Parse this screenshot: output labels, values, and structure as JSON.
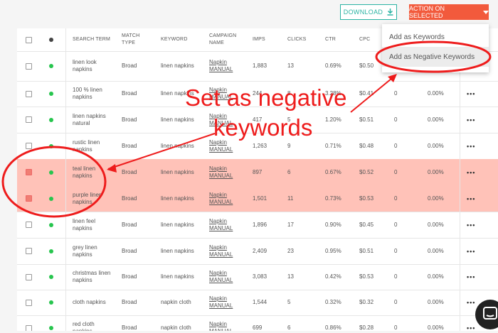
{
  "toolbar": {
    "download_label": "DOWNLOAD",
    "action_label": "ACTION ON SELECTED",
    "download_icon": "download-icon",
    "caret_icon": "caret-down-icon"
  },
  "columns": {
    "search_term": "SEARCH TERM",
    "match_type": "MATCH TYPE",
    "keyword": "KEYWORD",
    "campaign": "CAMPAIGN NAME",
    "imps": "IMPS",
    "clicks": "CLICKS",
    "ctr": "CTR",
    "cpc": "CPC"
  },
  "rows": [
    {
      "term": "linen look napkins",
      "match": "Broad",
      "keyword": "linen napkins",
      "campaign": "Napkin MANUAL",
      "imps": "1,883",
      "clicks": "13",
      "ctr": "0.69%",
      "cpc": "$0.50",
      "extra1": "",
      "extra2": "",
      "checked": false
    },
    {
      "term": "100 % linen napkins",
      "match": "Broad",
      "keyword": "linen napkins",
      "campaign": "Napkin MANUAL",
      "imps": "244",
      "clicks": "8",
      "ctr": "3.28%",
      "cpc": "$0.41",
      "extra1": "0",
      "extra2": "0.00%",
      "checked": false
    },
    {
      "term": "linen napkins natural",
      "match": "Broad",
      "keyword": "linen napkins",
      "campaign": "Napkin MANUAL",
      "imps": "417",
      "clicks": "5",
      "ctr": "1.20%",
      "cpc": "$0.51",
      "extra1": "0",
      "extra2": "0.00%",
      "checked": false
    },
    {
      "term": "rustic linen napkins",
      "match": "Broad",
      "keyword": "linen napkins",
      "campaign": "Napkin MANUAL",
      "imps": "1,263",
      "clicks": "9",
      "ctr": "0.71%",
      "cpc": "$0.48",
      "extra1": "0",
      "extra2": "0.00%",
      "checked": false
    },
    {
      "term": "teal linen napkins",
      "match": "Broad",
      "keyword": "linen napkins",
      "campaign": "Napkin MANUAL",
      "imps": "897",
      "clicks": "6",
      "ctr": "0.67%",
      "cpc": "$0.52",
      "extra1": "0",
      "extra2": "0.00%",
      "checked": true
    },
    {
      "term": "purple linen napkins",
      "match": "Broad",
      "keyword": "linen napkins",
      "campaign": "Napkin MANUAL",
      "imps": "1,501",
      "clicks": "11",
      "ctr": "0.73%",
      "cpc": "$0.53",
      "extra1": "0",
      "extra2": "0.00%",
      "checked": true
    },
    {
      "term": "linen feel napkins",
      "match": "Broad",
      "keyword": "linen napkins",
      "campaign": "Napkin MANUAL",
      "imps": "1,896",
      "clicks": "17",
      "ctr": "0.90%",
      "cpc": "$0.45",
      "extra1": "0",
      "extra2": "0.00%",
      "checked": false
    },
    {
      "term": "grey linen napkins",
      "match": "Broad",
      "keyword": "linen napkins",
      "campaign": "Napkin MANUAL",
      "imps": "2,409",
      "clicks": "23",
      "ctr": "0.95%",
      "cpc": "$0.51",
      "extra1": "0",
      "extra2": "0.00%",
      "checked": false
    },
    {
      "term": "christmas linen napkins",
      "match": "Broad",
      "keyword": "linen napkins",
      "campaign": "Napkin MANUAL",
      "imps": "3,083",
      "clicks": "13",
      "ctr": "0.42%",
      "cpc": "$0.53",
      "extra1": "0",
      "extra2": "0.00%",
      "checked": false
    },
    {
      "term": "cloth napkins",
      "match": "Broad",
      "keyword": "napkin cloth",
      "campaign": "Napkin MANUAL",
      "imps": "1,544",
      "clicks": "5",
      "ctr": "0.32%",
      "cpc": "$0.32",
      "extra1": "0",
      "extra2": "0.00%",
      "checked": false
    },
    {
      "term": "red cloth napkins",
      "match": "Broad",
      "keyword": "napkin cloth",
      "campaign": "Napkin MANUAL",
      "imps": "699",
      "clicks": "6",
      "ctr": "0.86%",
      "cpc": "$0.28",
      "extra1": "0",
      "extra2": "0.00%",
      "checked": false
    }
  ],
  "menu": {
    "item1": "Add as Keywords",
    "item2": "Add as Negative Keywords"
  },
  "annotation": {
    "line1": "Set as negative",
    "line2": "keywords",
    "color": "#ee1c1c"
  },
  "chat_icon": "chat-bubble-icon"
}
